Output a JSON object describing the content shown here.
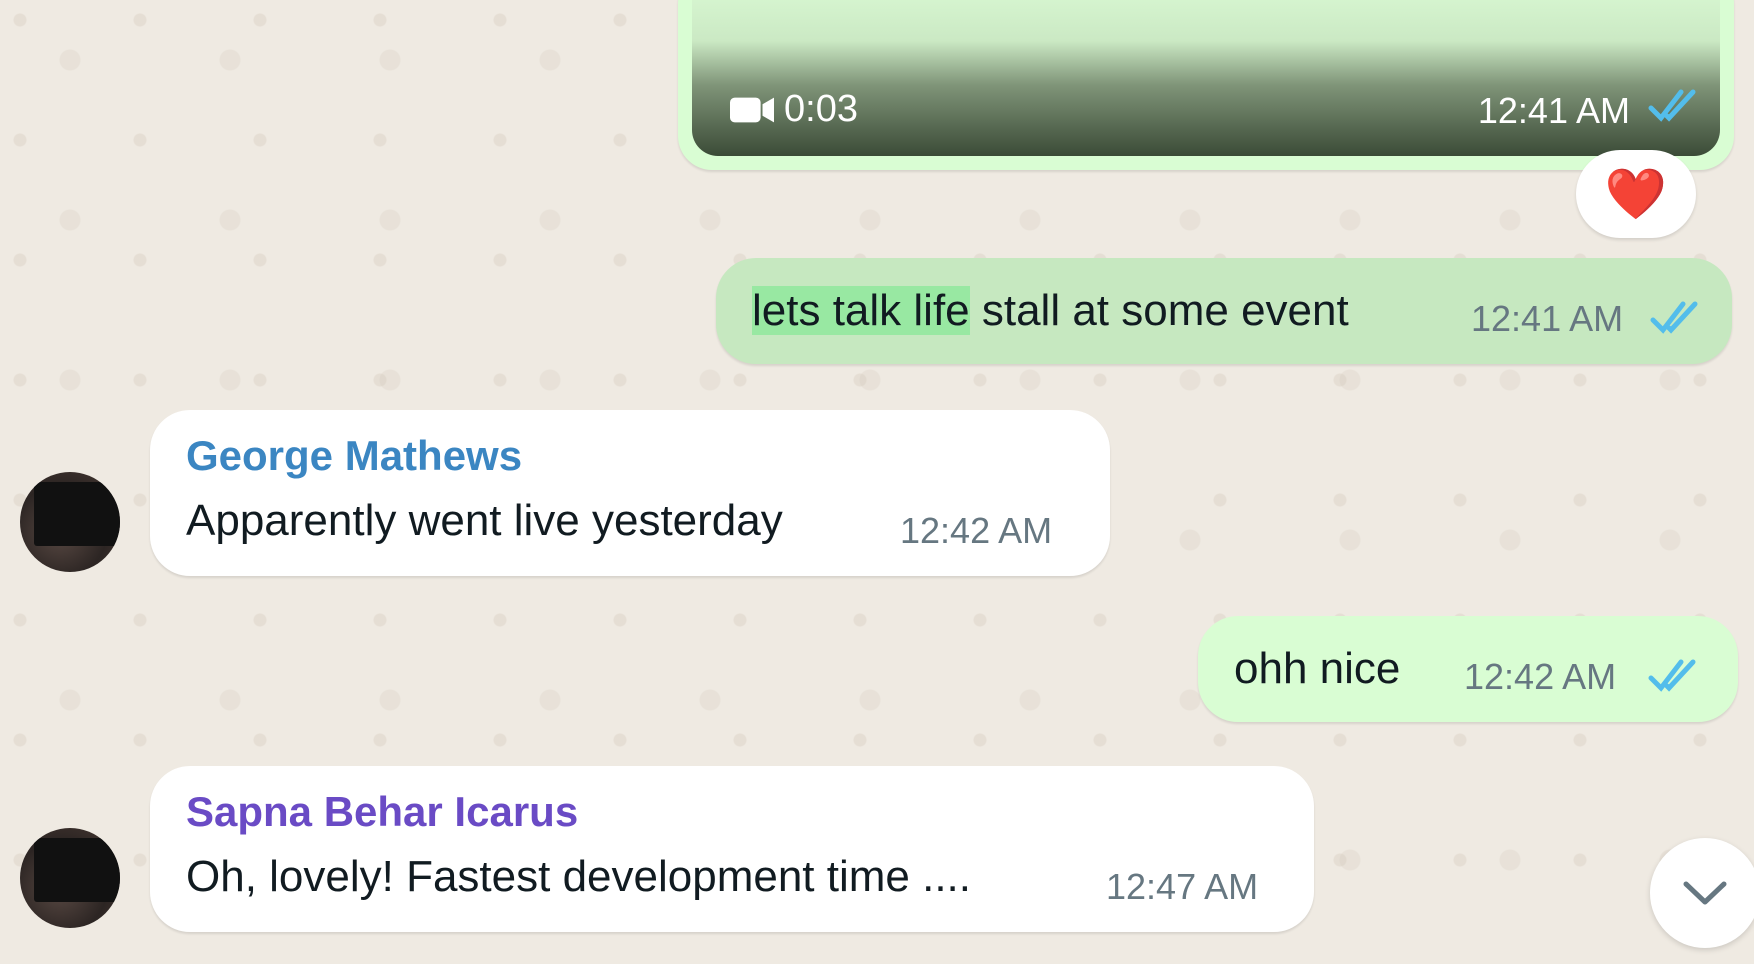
{
  "messages": {
    "video": {
      "duration": "0:03",
      "time": "12:41 AM",
      "reaction": "❤️"
    },
    "m1": {
      "text_highlight": "lets talk life",
      "text_rest": " stall at some event",
      "time": "12:41 AM"
    },
    "m2": {
      "sender": "George Mathews",
      "text": "Apparently went live yesterday",
      "time": "12:42 AM"
    },
    "m3": {
      "text": "ohh nice",
      "time": "12:42 AM"
    },
    "m4": {
      "sender": "Sapna Behar Icarus",
      "text": "Oh, lovely! Fastest development time ....",
      "time": "12:47 AM"
    }
  },
  "colors": {
    "outgoing_bubble": "#d9fdd3",
    "incoming_bubble": "#ffffff",
    "read_ticks": "#53bdeb",
    "sender_george": "#3b86c2",
    "sender_sapna": "#6a4bc5",
    "chat_background": "#efeae2"
  },
  "icons": {
    "video": "video-camera-icon",
    "read": "double-check-icon",
    "scroll": "chevron-down-icon"
  }
}
